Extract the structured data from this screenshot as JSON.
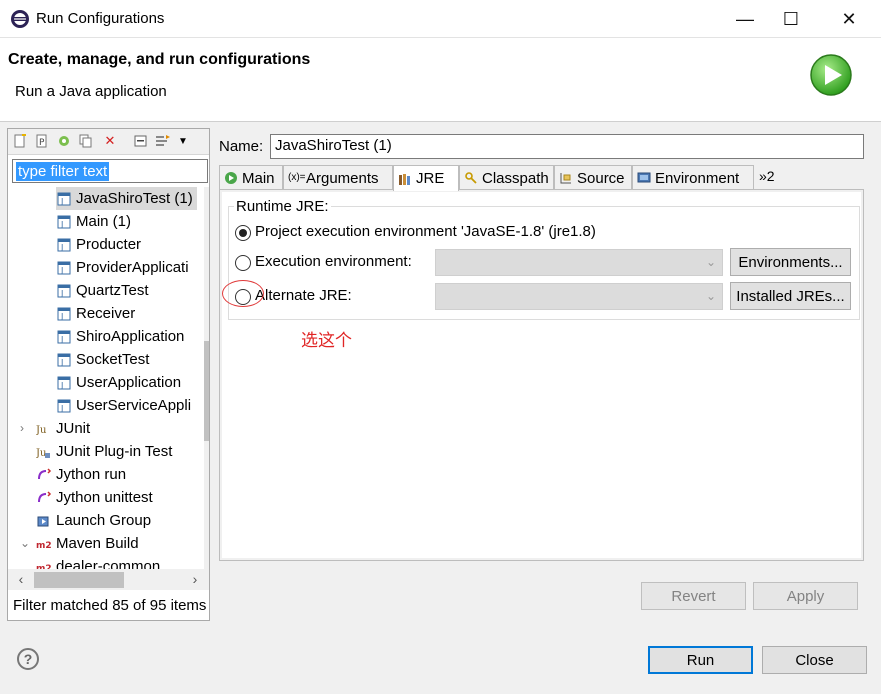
{
  "window": {
    "title": "Run Configurations",
    "minimize": "—",
    "maximize": "☐",
    "close": "✕"
  },
  "banner": {
    "title": "Create, manage, and run configurations",
    "subtitle": "Run a Java application"
  },
  "left": {
    "filter_text": "type filter text",
    "tree": [
      {
        "label": "JavaShiroTest (1)",
        "icon": "java-app-icon",
        "selected": true
      },
      {
        "label": "Main (1)",
        "icon": "java-app-icon"
      },
      {
        "label": "Producter",
        "icon": "java-app-icon"
      },
      {
        "label": "ProviderApplicati",
        "icon": "java-app-icon"
      },
      {
        "label": "QuartzTest",
        "icon": "java-app-icon"
      },
      {
        "label": "Receiver",
        "icon": "java-app-icon"
      },
      {
        "label": "ShiroApplication",
        "icon": "java-app-icon"
      },
      {
        "label": "SocketTest",
        "icon": "java-app-icon"
      },
      {
        "label": "UserApplication",
        "icon": "java-app-icon"
      },
      {
        "label": "UserServiceAppli",
        "icon": "java-app-icon"
      },
      {
        "label": "JUnit",
        "icon": "junit-icon",
        "twisty": "›"
      },
      {
        "label": "JUnit Plug-in Test",
        "icon": "junit-plugin-icon"
      },
      {
        "label": "Jython run",
        "icon": "jython-icon"
      },
      {
        "label": "Jython unittest",
        "icon": "jython-icon"
      },
      {
        "label": "Launch Group",
        "icon": "launch-group-icon"
      },
      {
        "label": "Maven Build",
        "icon": "maven-icon",
        "twisty": "⌄"
      },
      {
        "label": "dealer-common",
        "icon": "maven-icon"
      }
    ],
    "status": "Filter matched 85 of 95 items"
  },
  "config": {
    "name_label": "Name:",
    "name_value": "JavaShiroTest (1)",
    "tabs": [
      "Main",
      "Arguments",
      "JRE",
      "Classpath",
      "Source",
      "Environment"
    ],
    "tabs_more": "»2",
    "active_tab": "JRE",
    "runtime_jre_label": "Runtime JRE:",
    "options": [
      {
        "label": "Project execution environment 'JavaSE-1.8' (jre1.8)",
        "selected": true
      },
      {
        "label": "Execution environment:",
        "selected": false
      },
      {
        "label": "Alternate JRE:",
        "selected": false
      }
    ],
    "environments_button": "Environments...",
    "installed_jres_button": "Installed JREs...",
    "annotation": "选这个",
    "revert_button": "Revert",
    "apply_button": "Apply"
  },
  "footer": {
    "help": "?",
    "run_button": "Run",
    "close_button": "Close"
  },
  "colors": {
    "selection": "#3399ff",
    "annotation": "#e02525",
    "default_button_border": "#0078d7"
  }
}
